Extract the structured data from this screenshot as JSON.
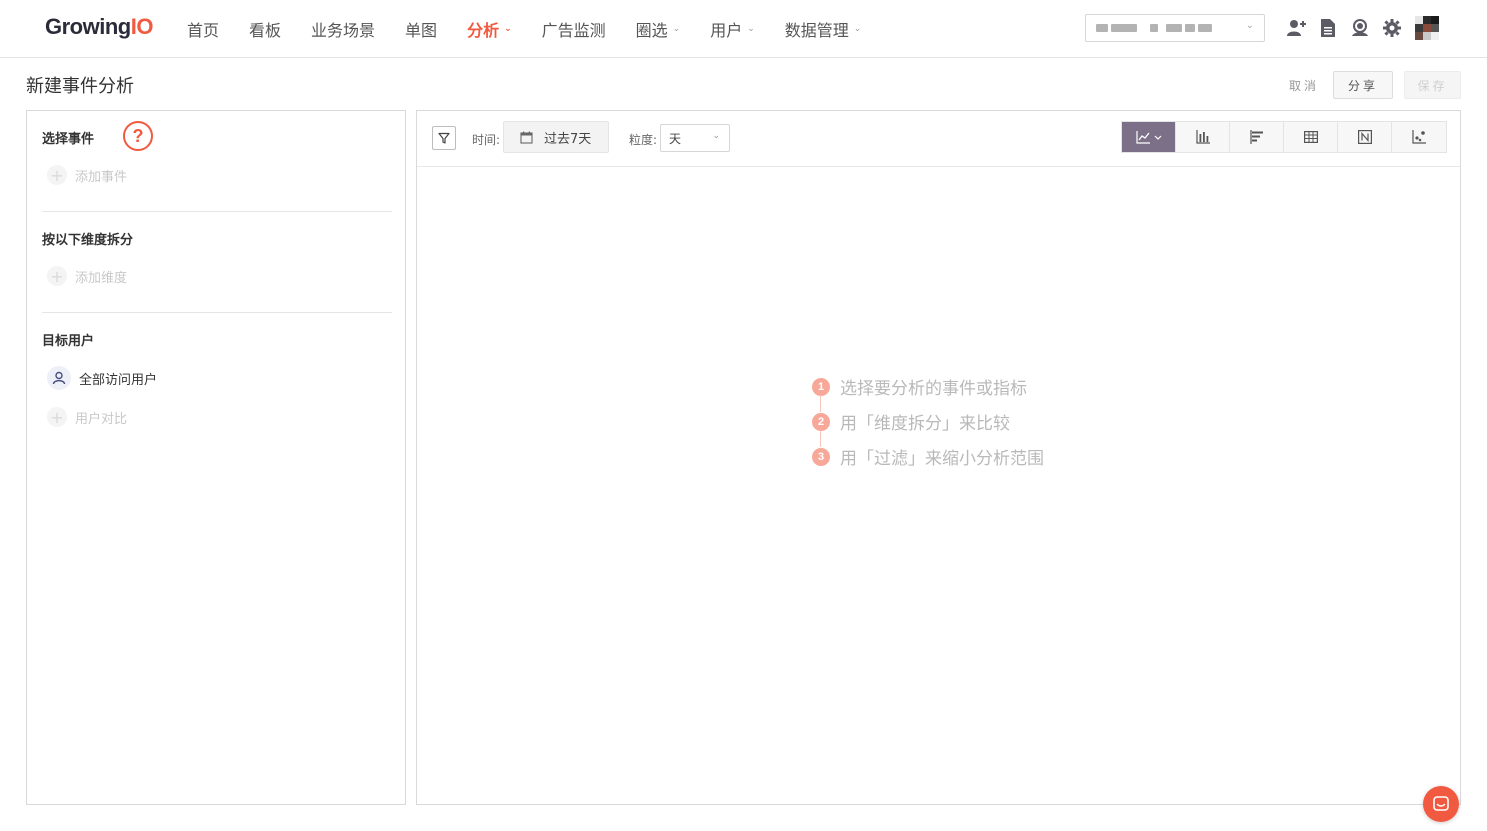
{
  "brand": {
    "logo_prefix": "Growing",
    "logo_suffix": "IO",
    "accent": "#f15a40"
  },
  "nav": {
    "items": [
      {
        "label": "首页"
      },
      {
        "label": "看板"
      },
      {
        "label": "业务场景"
      },
      {
        "label": "单图"
      },
      {
        "label": "分析",
        "active": true
      },
      {
        "label": "广告监测"
      },
      {
        "label": "圈选"
      },
      {
        "label": "用户"
      },
      {
        "label": "数据管理"
      }
    ]
  },
  "header": {
    "icons": [
      "add-user-icon",
      "document-icon",
      "support-icon",
      "gear-icon",
      "avatar"
    ]
  },
  "page": {
    "title": "新建事件分析",
    "cancel_label": "取消",
    "share_label": "分享",
    "save_label": "保存"
  },
  "left_panel": {
    "select_event_title": "选择事件",
    "help_label": "?",
    "add_event_label": "添加事件",
    "split_title": "按以下维度拆分",
    "add_dimension_label": "添加维度",
    "target_users_title": "目标用户",
    "all_users_label": "全部访问用户",
    "user_compare_label": "用户对比"
  },
  "toolbar": {
    "time_label": "时间:",
    "time_value": "过去7天",
    "granularity_label": "粒度:",
    "granularity_value": "天",
    "chart_types": [
      "line-chart",
      "bar-chart",
      "horizontal-bar-chart",
      "table",
      "number",
      "scatter"
    ],
    "active_chart_type": "line-chart"
  },
  "empty_state": {
    "steps": [
      {
        "num": "1",
        "text": "选择要分析的事件或指标"
      },
      {
        "num": "2",
        "text": "用「维度拆分」来比较"
      },
      {
        "num": "3",
        "text": "用「过滤」来缩小分析范围"
      }
    ]
  }
}
